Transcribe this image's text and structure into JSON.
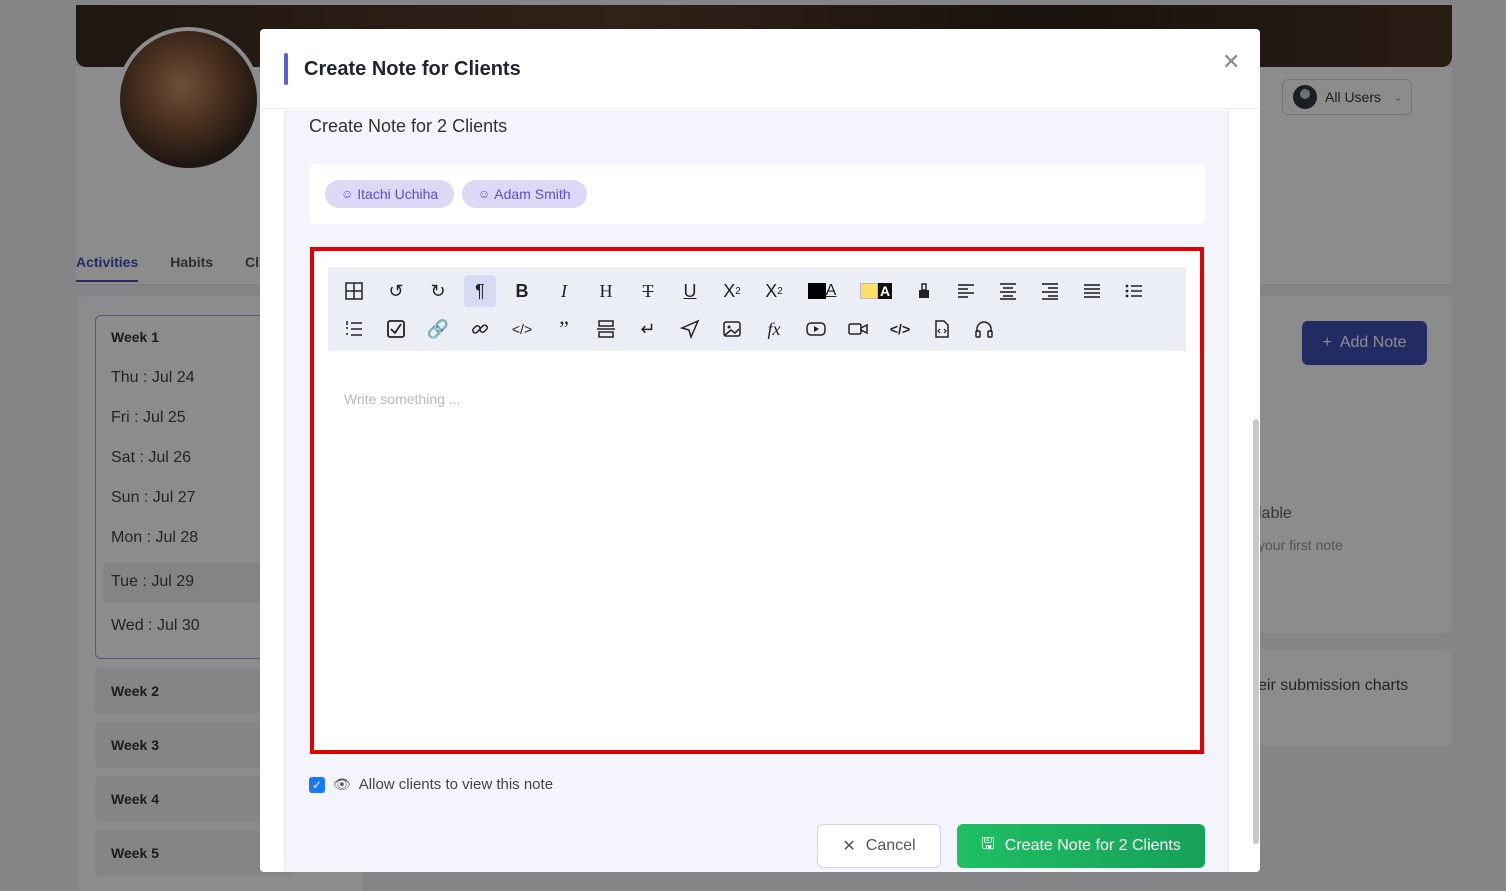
{
  "background": {
    "all_users_label": "All Users",
    "tabs": [
      "Activities",
      "Habits",
      "Cl"
    ],
    "week1_title": "Week 1",
    "days": [
      "Thu : Jul 24",
      "Fri : Jul 25",
      "Sat : Jul 26",
      "Sun : Jul 27",
      "Mon : Jul 28",
      "Tue : Jul 29",
      "Wed : Jul 30"
    ],
    "weeks": [
      "Week 2",
      "Week 3",
      "Week 4",
      "Week 5"
    ],
    "add_note_label": "Add Note",
    "partial_text_1": "lable",
    "partial_text_2": "your first note",
    "partial_text_3": "eir submission charts"
  },
  "modal": {
    "title": "Create Note for Clients",
    "section_title": "Create Note for 2 Clients",
    "clients": [
      "Itachi Uchiha",
      "Adam Smith"
    ],
    "editor_placeholder": "Write something ...",
    "toolbar_row1": [
      "table-icon",
      "undo-icon",
      "redo-icon",
      "paragraph-icon",
      "bold-icon",
      "italic-icon",
      "heading-icon",
      "strikethrough-icon",
      "underline-icon",
      "subscript-icon",
      "superscript-icon",
      "font-color-icon",
      "highlight-color-icon",
      "clear-format-icon",
      "align-left-icon",
      "align-center-icon",
      "align-right-icon",
      "align-justify-icon",
      "bullet-list-icon"
    ],
    "toolbar_row2": [
      "ordered-list-icon",
      "checklist-icon",
      "link-icon",
      "unlink-icon",
      "code-icon",
      "quote-icon",
      "horizontal-rule-icon",
      "line-break-icon",
      "send-icon",
      "image-icon",
      "formula-icon",
      "youtube-icon",
      "video-icon",
      "code-block-icon",
      "file-icon",
      "audio-icon"
    ],
    "allow_label": "Allow clients to view this note",
    "allow_checked": true,
    "cancel_label": "Cancel",
    "create_label": "Create Note for 2 Clients",
    "colors": {
      "accent": "#5b5fd6",
      "primary": "#3f51b5",
      "success": "#1fbf63",
      "highlight_border": "#e00000"
    }
  }
}
